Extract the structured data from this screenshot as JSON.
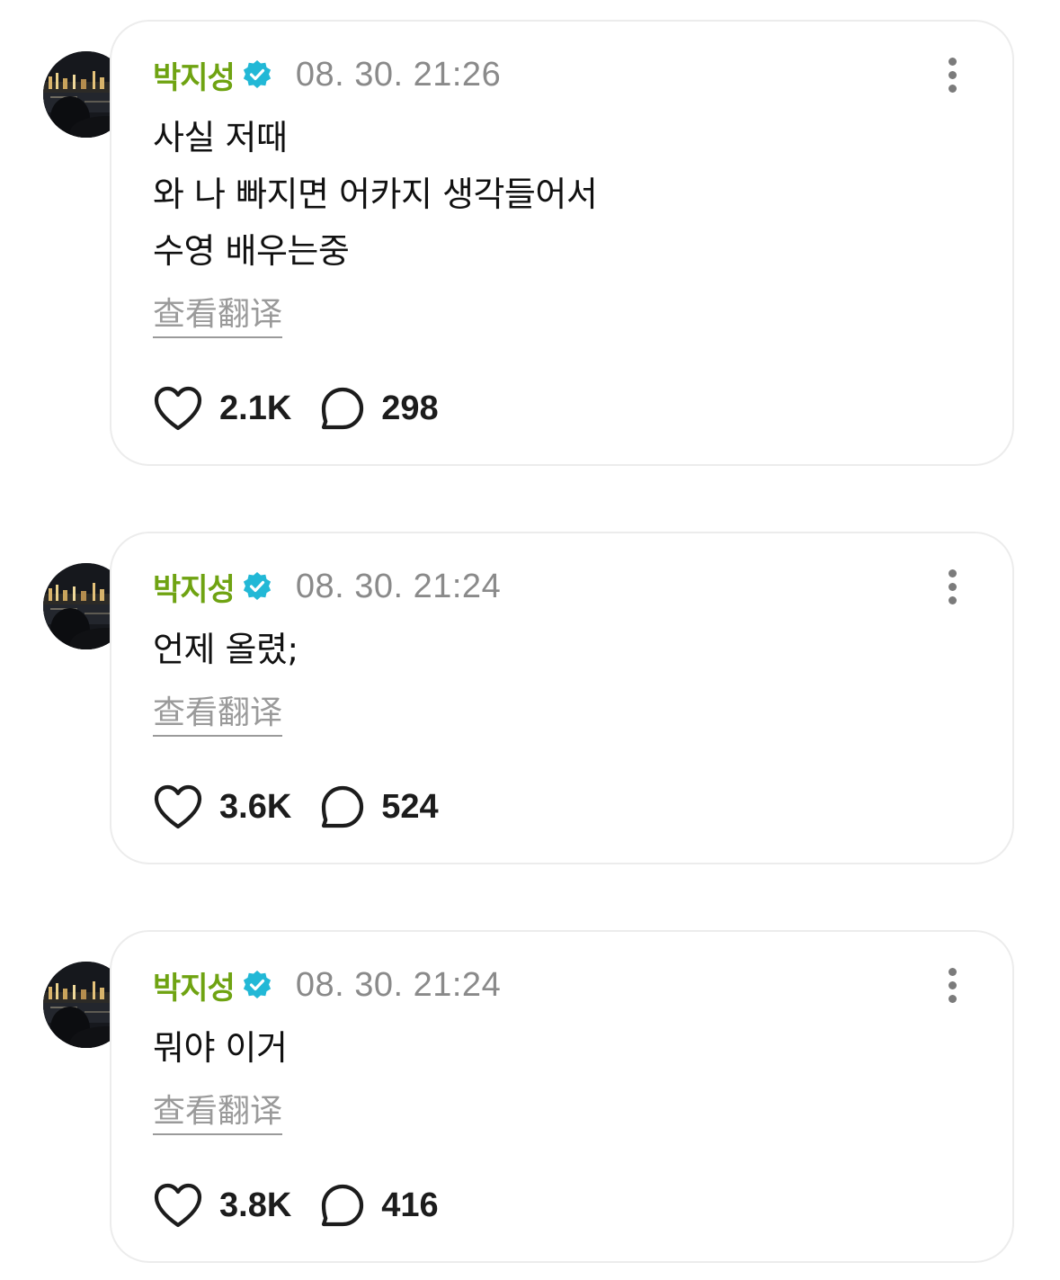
{
  "colors": {
    "author": "#6fa312",
    "verified_badge": "#22b8d6",
    "timestamp": "#8a8a8a",
    "text": "#111111",
    "translate_link": "#9a9a9a",
    "card_border": "#ececec"
  },
  "icons": {
    "like": "heart-icon",
    "comment": "comment-bubble-icon",
    "verified": "verified-badge-icon",
    "more": "more-options-icon"
  },
  "posts": [
    {
      "author": "박지성",
      "verified": true,
      "timestamp": "08. 30. 21:26",
      "text_lines": [
        "사실 저때",
        "와 나 빠지면 어카지 생각들어서",
        "수영 배우는중"
      ],
      "translate_label": "查看翻译",
      "likes": "2.1K",
      "comments": "298"
    },
    {
      "author": "박지성",
      "verified": true,
      "timestamp": "08. 30. 21:24",
      "text_lines": [
        "언제 올렸;"
      ],
      "translate_label": "查看翻译",
      "likes": "3.6K",
      "comments": "524"
    },
    {
      "author": "박지성",
      "verified": true,
      "timestamp": "08. 30. 21:24",
      "text_lines": [
        "뭐야 이거"
      ],
      "translate_label": "查看翻译",
      "likes": "3.8K",
      "comments": "416"
    }
  ]
}
